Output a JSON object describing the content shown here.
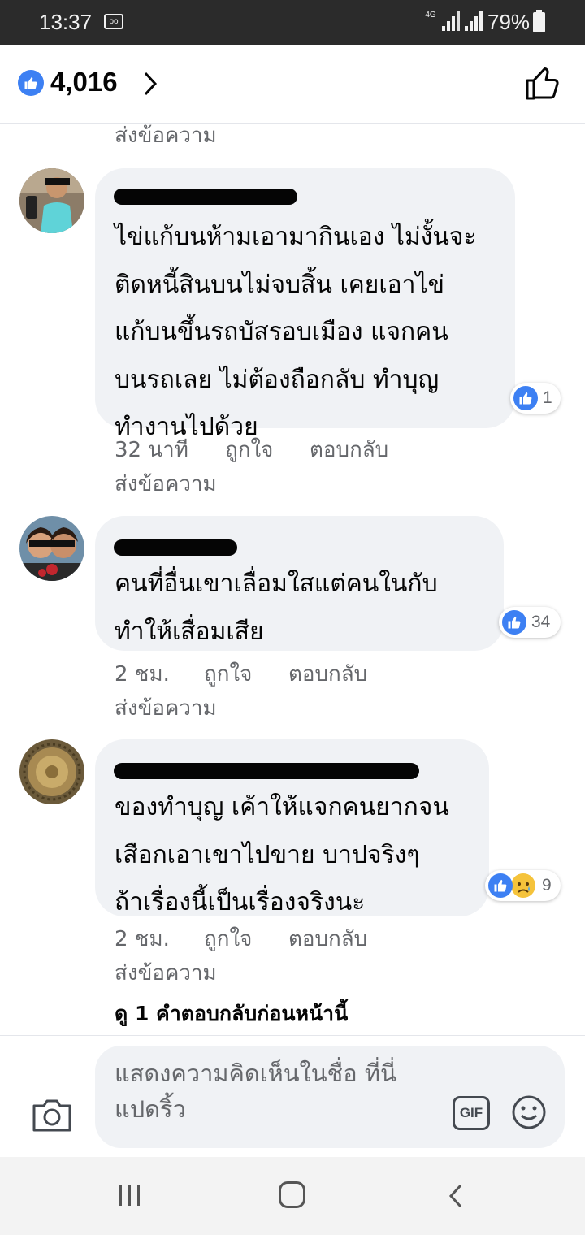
{
  "status_bar": {
    "time": "13:37",
    "network": "4G",
    "battery": "79%",
    "icons": [
      "voicemail-icon",
      "signal-icon",
      "signal-icon",
      "battery-icon"
    ]
  },
  "header": {
    "like_count": "4,016",
    "icons": [
      "like-badge-icon",
      "chevron-right-icon",
      "thumbs-up-icon"
    ]
  },
  "send_message_label": "ส่งข้อความ",
  "comments": [
    {
      "lines": [
        "ไข่แก้บนห้ามเอามากินเอง ไม่งั้นจะ",
        "ติดหนี้สินบนไม่จบสิ้น เคยเอาไข่",
        "แก้บนขึ้นรถบัสรอบเมือง แจกคน",
        "บนรถเลย ไม่ต้องถือกลับ ทำบุญ",
        "ทำงานไปด้วย"
      ],
      "time": "32 นาที",
      "like_label": "ถูกใจ",
      "reply_label": "ตอบกลับ",
      "send_label": "ส่งข้อความ",
      "reaction_count": "1"
    },
    {
      "lines": [
        "คนที่อื่นเขาเลื่อมใสแต่คนในกับ",
        "ทำให้เสื่อมเสีย"
      ],
      "time": "2 ชม.",
      "like_label": "ถูกใจ",
      "reply_label": "ตอบกลับ",
      "send_label": "ส่งข้อความ",
      "reaction_count": "34"
    },
    {
      "lines": [
        "ของทำบุญ เค้าให้แจกคนยากจน",
        "เสือกเอาเขาไปขาย บาปจริงๆ",
        "ถ้าเรื่องนี้เป็นเรื่องจริงนะ"
      ],
      "time": "2 ชม.",
      "like_label": "ถูกใจ",
      "reply_label": "ตอบกลับ",
      "send_label": "ส่งข้อความ",
      "reaction_count": "9"
    }
  ],
  "view_previous_replies": "ดู 1 คำตอบกลับก่อนหน้านี้",
  "composer": {
    "placeholder": "แสดงความคิดเห็นในชื่อ ที่นี่แปดริ้ว",
    "gif_label": "GIF",
    "icons": [
      "camera-icon",
      "gif-icon",
      "emoji-icon"
    ]
  },
  "colors": {
    "accent": "#3d80f3",
    "bubble": "#f0f2f5",
    "meta_text": "#65676b",
    "status_bar": "#2b2b2b"
  }
}
